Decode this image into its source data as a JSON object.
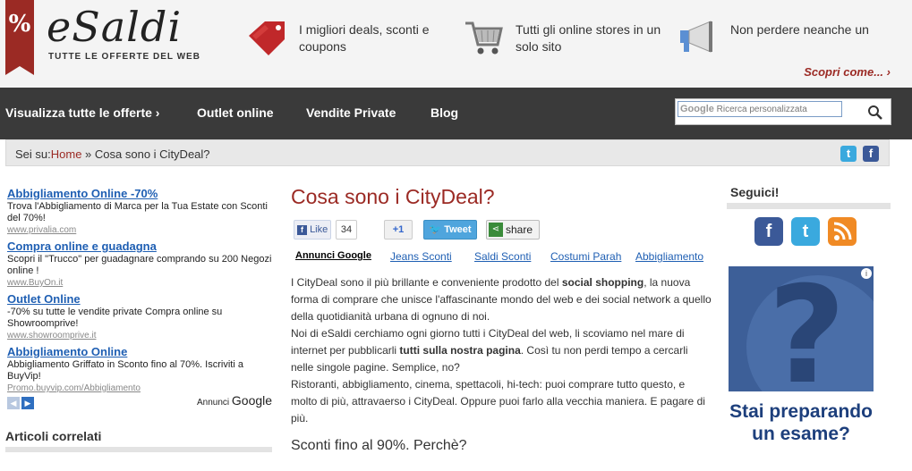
{
  "header": {
    "logo": "eSaldi",
    "tagline": "TUTTE LE OFFERTE DEL WEB",
    "features": [
      {
        "text": "I migliori deals, sconti e coupons",
        "icon": "price-tag-icon"
      },
      {
        "text": "Tutti gli online stores in un solo sito",
        "icon": "shopping-cart-icon"
      },
      {
        "text": "Non perdere neanche un",
        "icon": "megaphone-icon"
      }
    ],
    "scopri": "Scopri come... ›"
  },
  "nav": {
    "items": [
      "Visualizza tutte le offerte ›",
      "Outlet online",
      "Vendite Private",
      "Blog"
    ],
    "search_placeholder": "Ricerca personalizzata",
    "search_brand": "Google"
  },
  "breadcrumb": {
    "prefix": "Sei su:",
    "home": "Home",
    "separator": " » ",
    "current": "Cosa sono i CityDeal?"
  },
  "ads": [
    {
      "title": "Abbigliamento Online -70%",
      "text": "Trova l'Abbigliamento di Marca per la Tua Estate con Sconti del 70%!",
      "url": "www.privalia.com"
    },
    {
      "title": "Compra online e guadagna",
      "text": "Scopri il \"Trucco\" per guadagnare comprando su 200 Negozi online !",
      "url": "www.BuyOn.it"
    },
    {
      "title": "Outlet Online",
      "text": "-70% su tutte le vendite private Compra online su Showroomprive!",
      "url": "www.showroomprive.it"
    },
    {
      "title": "Abbigliamento Online",
      "text": "Abbigliamento Griffato in Sconto fino al 70%. Iscriviti a BuyVip!",
      "url": "Promo.buyvip.com/Abbigliamento"
    }
  ],
  "ads_footer": {
    "annunci": "Annunci",
    "google": "Google"
  },
  "related_title": "Articoli correlati",
  "article": {
    "title": "Cosa sono i CityDeal?",
    "share": {
      "like": "Like",
      "like_count": "34",
      "plusone": "+1",
      "tweet": "Tweet",
      "share": "share"
    },
    "tabs": [
      "Annunci Google",
      "Jeans Sconti",
      "Saldi Sconti",
      "Costumi Parah",
      "Abbigliamento"
    ],
    "p1_a": "I CityDeal sono il più brillante e conveniente prodotto del ",
    "p1_b": "social shopping",
    "p1_c": ", la nuova forma di comprare che unisce l'affascinante mondo del web e dei social network a quello della quotidianità urbana di ognuno di noi.",
    "p2_a": "Noi di eSaldi cerchiamo ogni giorno tutti i CityDeal del web, li scoviamo nel mare di internet per pubblicarli ",
    "p2_b": "tutti sulla nostra pagina",
    "p2_c": ". Così tu non perdi tempo a cercarli nelle singole pagine. Semplice, no?",
    "p3": "Ristoranti, abbigliamento, cinema, spettacoli, hi-tech: puoi comprare tutto questo, e molto di più, attravaerso i CityDeal. Oppure puoi farlo alla vecchia maniera. E pagare di più.",
    "subtitle": "Sconti fino al 90%. Perchè?"
  },
  "sidebar": {
    "follow_title": "Seguici!",
    "ad_text": "Stai preparando un esame?",
    "ad_info": "i"
  },
  "colors": {
    "brand": "#9b2a24",
    "nav": "#3a3a3a",
    "link": "#1f5fb3"
  }
}
